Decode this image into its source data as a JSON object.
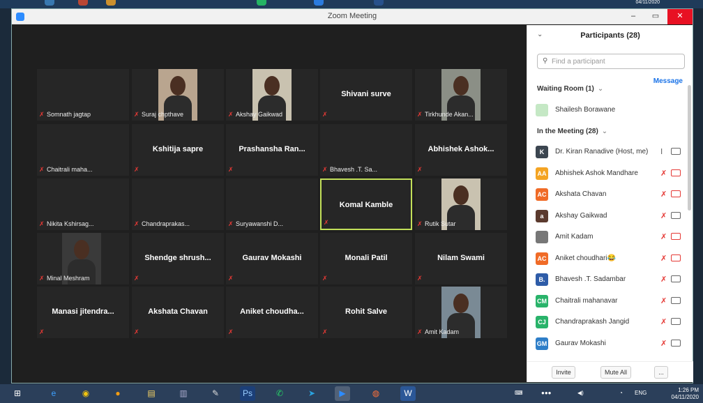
{
  "window": {
    "title": "Zoom Meeting"
  },
  "top_strip": {
    "date": "04/11/2020"
  },
  "gallery": {
    "tiles": [
      {
        "label": "Somnath jagtap",
        "type": "caption"
      },
      {
        "label": "Suraj chpthave",
        "type": "video"
      },
      {
        "label": "Akshay Gaikwad",
        "type": "video"
      },
      {
        "label": "Shivani surve",
        "type": "name"
      },
      {
        "label": "Tirkhunde Akan...",
        "type": "video"
      },
      {
        "label": "Chaitrali maha...",
        "type": "caption"
      },
      {
        "label": "Kshitija sapre",
        "type": "name"
      },
      {
        "label": "Prashansha Ran...",
        "type": "name"
      },
      {
        "label": "Bhavesh .T. Sa...",
        "type": "caption"
      },
      {
        "label": "Abhishek Ashok...",
        "type": "name"
      },
      {
        "label": "Nikita Kshirsag...",
        "type": "caption"
      },
      {
        "label": "Chandraprakas...",
        "type": "caption"
      },
      {
        "label": "Suryawanshi D...",
        "type": "caption"
      },
      {
        "label": "Komal Kamble",
        "type": "name",
        "active": true
      },
      {
        "label": "Rutik Sutar",
        "type": "video"
      },
      {
        "label": "Minal Meshram",
        "type": "video"
      },
      {
        "label": "Shendge shrush...",
        "type": "name"
      },
      {
        "label": "Gaurav Mokashi",
        "type": "name"
      },
      {
        "label": "Monali Patil",
        "type": "name"
      },
      {
        "label": "Nilam Swami",
        "type": "name"
      },
      {
        "label": "Manasi jitendra...",
        "type": "name"
      },
      {
        "label": "Akshata Chavan",
        "type": "name"
      },
      {
        "label": "Aniket choudha...",
        "type": "name"
      },
      {
        "label": "Rohit Salve",
        "type": "name"
      },
      {
        "label": "Amit Kadam",
        "type": "video"
      }
    ]
  },
  "panel": {
    "title": "Participants (28)",
    "search_placeholder": "Find a participant",
    "waiting_room": "Waiting Room (1)",
    "message_label": "Message",
    "waiting_user": "Shailesh Borawane",
    "in_meeting": "In the Meeting (28)",
    "participants": [
      {
        "initials": "K",
        "name": "Dr. Kiran Ranadive (Host, me)",
        "color": "#3c4650",
        "mic": "on",
        "cam": "on"
      },
      {
        "initials": "AA",
        "name": "Abhishek Ashok Mandhare",
        "color": "#f4a423",
        "mic": "off",
        "cam": "off"
      },
      {
        "initials": "AC",
        "name": "Akshata Chavan",
        "color": "#f06b27",
        "mic": "off",
        "cam": "off"
      },
      {
        "initials": "a",
        "name": "Akshay Gaikwad",
        "color": "#5b3a2e",
        "mic": "off",
        "cam": "on"
      },
      {
        "initials": "",
        "name": "Amit Kadam",
        "color": "#777777",
        "mic": "off",
        "cam": "off"
      },
      {
        "initials": "AC",
        "name": "Aniket choudhari😂",
        "color": "#f06b27",
        "mic": "off",
        "cam": "off"
      },
      {
        "initials": "B.",
        "name": "Bhavesh .T. Sadambar",
        "color": "#2e5ca8",
        "mic": "off",
        "cam": "on"
      },
      {
        "initials": "CM",
        "name": "Chaitrali mahanavar",
        "color": "#29b36a",
        "mic": "off",
        "cam": "on"
      },
      {
        "initials": "CJ",
        "name": "Chandraprakash Jangid",
        "color": "#29b36a",
        "mic": "off",
        "cam": "on"
      },
      {
        "initials": "GM",
        "name": "Gaurav Mokashi",
        "color": "#2e7ec8",
        "mic": "off",
        "cam": "on"
      }
    ],
    "invite": "Invite",
    "mute_all": "Mute All",
    "more": "..."
  },
  "taskbar": {
    "lang": "ENG",
    "time": "1:26 PM",
    "date": "04/11/2020"
  }
}
